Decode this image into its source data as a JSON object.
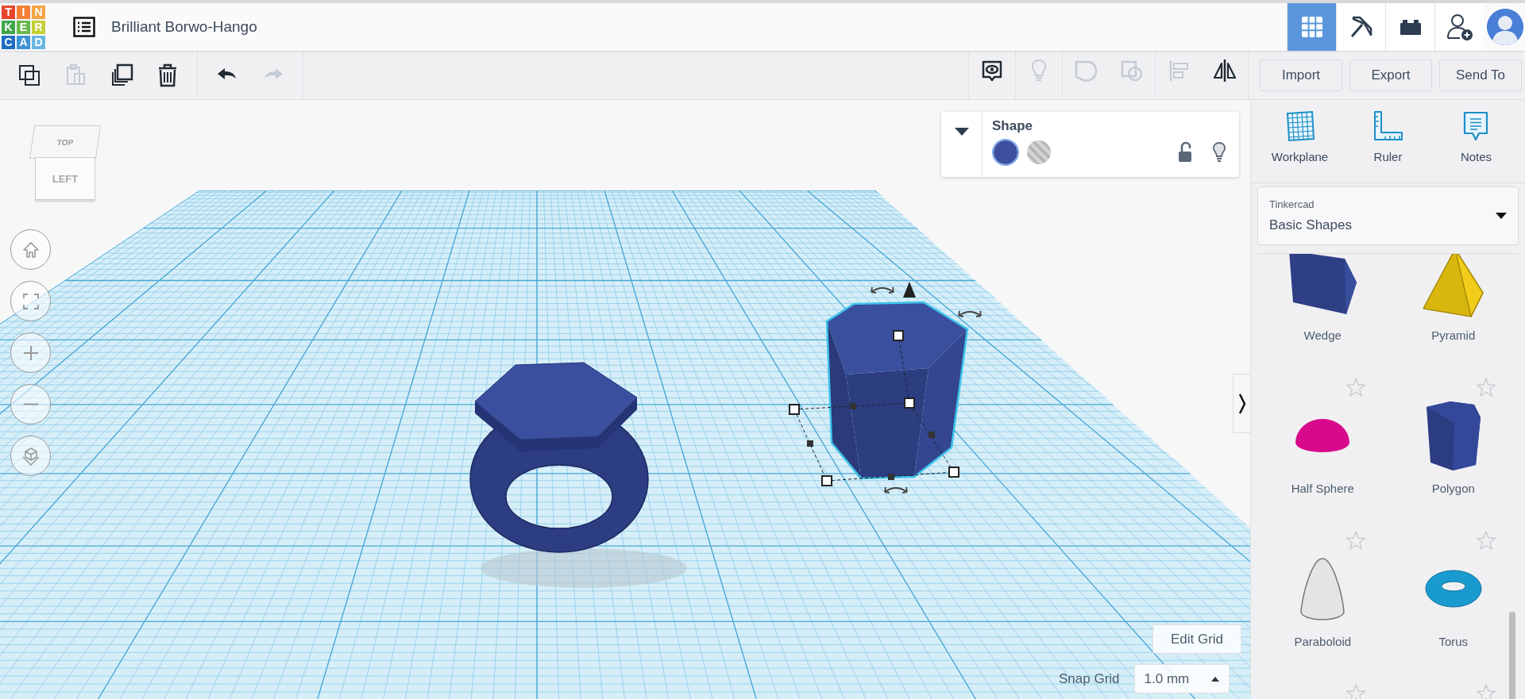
{
  "header": {
    "logo_letters": [
      "T",
      "I",
      "N",
      "K",
      "E",
      "R",
      "C",
      "A",
      "D"
    ],
    "project_title": "Brilliant Borwo-Hango"
  },
  "header_views": [
    {
      "kind": "grid",
      "selected": true
    },
    {
      "kind": "pickaxe",
      "selected": false
    },
    {
      "kind": "brick",
      "selected": false
    }
  ],
  "toolbar": {
    "edit_tools": [
      {
        "kind": "copy",
        "disabled": false
      },
      {
        "kind": "paste",
        "disabled": true
      },
      {
        "kind": "duplicate",
        "disabled": false
      },
      {
        "kind": "delete",
        "disabled": false
      }
    ],
    "history": [
      {
        "kind": "undo",
        "disabled": false
      },
      {
        "kind": "redo",
        "disabled": true
      }
    ],
    "view_tools": [
      {
        "kind": "notes_toggle",
        "disabled": false
      },
      {
        "kind": "bulb",
        "disabled": true
      },
      {
        "kind": "group",
        "disabled": true
      },
      {
        "kind": "ungroup",
        "disabled": true
      },
      {
        "kind": "align",
        "disabled": true
      },
      {
        "kind": "mirror",
        "disabled": false
      }
    ],
    "actions": [
      "Import",
      "Export",
      "Send To"
    ]
  },
  "view_cube": {
    "top": "TOP",
    "side": "LEFT"
  },
  "shape_panel": {
    "title": "Shape",
    "options": [
      {
        "kind": "solid",
        "selected": true
      },
      {
        "kind": "hole",
        "selected": false
      }
    ]
  },
  "sidebar": {
    "tools": [
      {
        "kind": "workplane",
        "label": "Workplane"
      },
      {
        "kind": "ruler",
        "label": "Ruler"
      },
      {
        "kind": "notes",
        "label": "Notes"
      }
    ],
    "library": {
      "source": "Tinkercad",
      "category": "Basic Shapes"
    },
    "shapes": [
      {
        "kind": "wedge",
        "label": "Wedge"
      },
      {
        "kind": "pyramid",
        "label": "Pyramid"
      },
      {
        "kind": "half_sphere",
        "label": "Half Sphere"
      },
      {
        "kind": "polygon",
        "label": "Polygon"
      },
      {
        "kind": "paraboloid",
        "label": "Paraboloid"
      },
      {
        "kind": "torus",
        "label": "Torus"
      },
      {
        "kind": "hidden"
      },
      {
        "kind": "hidden"
      }
    ]
  },
  "grid_controls": {
    "edit_grid": "Edit Grid",
    "snap_label": "Snap Grid",
    "snap_value": "1.0 mm"
  }
}
